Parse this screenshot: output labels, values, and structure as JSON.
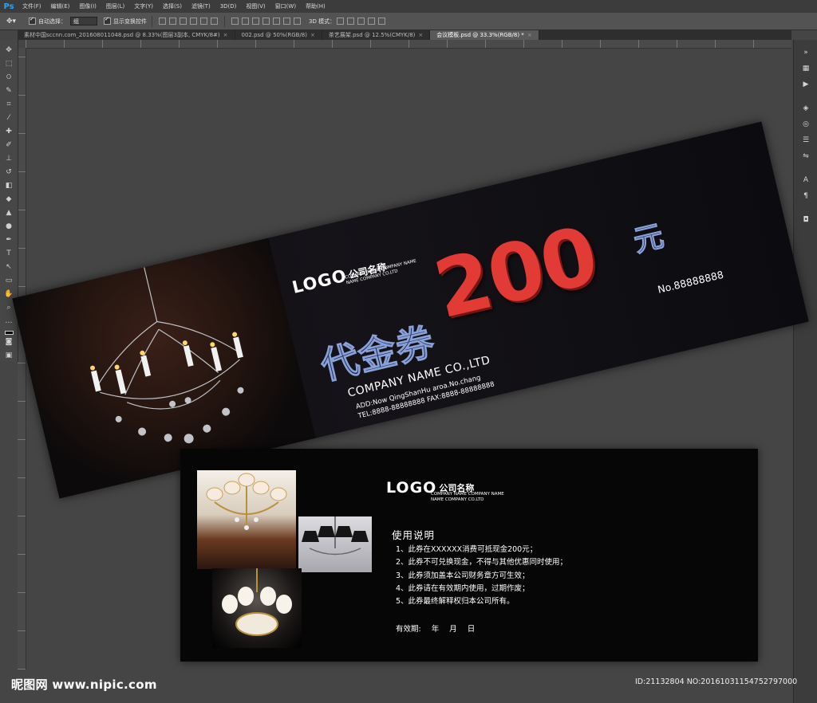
{
  "app": {
    "logo": "Ps"
  },
  "menu": [
    "文件(F)",
    "编辑(E)",
    "图像(I)",
    "图层(L)",
    "文字(Y)",
    "选择(S)",
    "滤镜(T)",
    "3D(D)",
    "视图(V)",
    "窗口(W)",
    "帮助(H)"
  ],
  "options": {
    "auto_select_label": "自动选择：",
    "auto_select_value": "组",
    "show_transform_label": "显示变换控件",
    "mode_3d_label": "3D 模式："
  },
  "tabs": [
    {
      "label": "素材中国sccnn.com_201608011048.psd @ 8.33%(图层3副本, CMYK/8#)",
      "close": "×",
      "active": false
    },
    {
      "label": "002.psd @ 50%(RGB/8)",
      "close": "×",
      "active": false
    },
    {
      "label": "茶艺展架.psd @ 12.5%(CMYK/8)",
      "close": "×",
      "active": false
    },
    {
      "label": "会议模板.psd @ 33.3%(RGB/8) *",
      "close": "×",
      "active": true
    }
  ],
  "voucher_front": {
    "logo": "LOGO",
    "company_cn": "公司名称",
    "company_sub_lines": [
      "COMPANY NAME COMPANY NAME",
      "NAME COMPANY CO.LTD"
    ],
    "title": "代金券",
    "amount": "200",
    "unit": "元",
    "serial": "No.88888888",
    "company_en": "COMPANY NAME CO.,LTD",
    "address": "ADD:Now QingShanHu aroa.No.chang",
    "tel_fax": "TEL:8888-88888888   FAX:8888-88888888"
  },
  "voucher_back": {
    "logo": "LOGO",
    "company_cn": "公司名称",
    "company_sub_lines": [
      "COMPANY NAME COMPANY NAME",
      "NAME COMPANY CO.LTD"
    ],
    "instructions_title": "使用说明",
    "rules": [
      "1、此券在XXXXXX消费可抵现金200元；",
      "2、此券不可兑换现金，不得与其他优惠同时使用；",
      "3、此券须加盖本公司财务章方可生效；",
      "4、此券请在有效期内使用，过期作废；",
      "5、此券最终解释权归本公司所有。"
    ],
    "validity": "有效期:      年    月    日"
  },
  "watermark": {
    "left": "昵图网 www.nipic.com",
    "right": "ID:21132804 NO:20161031154752797000"
  },
  "colors": {
    "accent_red": "#e23a35",
    "title_navy": "#1b2545",
    "canvas_bg": "#454545"
  }
}
